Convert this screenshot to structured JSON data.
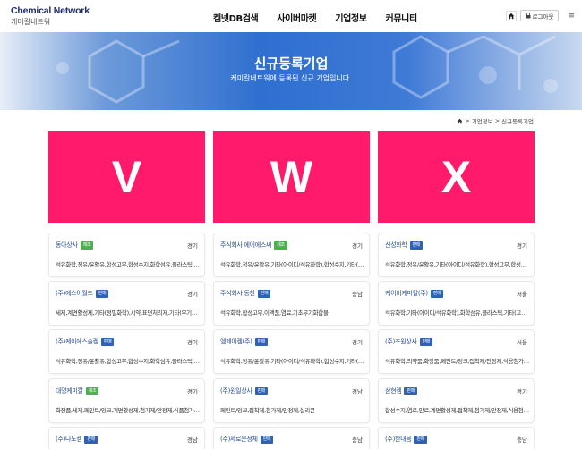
{
  "header": {
    "logo_en": "Chemical Network",
    "logo_ko": "케미칼네트워",
    "nav": [
      "켐넷DB검색",
      "사이버마켓",
      "기업정보",
      "커뮤니티"
    ],
    "login_label": "로그아웃",
    "icons": [
      "home-icon",
      "lock-icon",
      "menu-icon"
    ]
  },
  "banner": {
    "title": "신규등록기업",
    "subtitle": "케미칼네트워에 등록된 신규 기업입니다."
  },
  "breadcrumb": [
    "기업정보",
    "신규등록기업"
  ],
  "featured": [
    "V",
    "W",
    "X"
  ],
  "colors": {
    "featured_bg": "#ff1a6b",
    "badge_green": "#4caf50",
    "badge_blue": "#2f62b3",
    "link": "#2a4d8f"
  },
  "companies": [
    {
      "name": "동아상사",
      "badge": "제조",
      "badge_color": "#4caf50",
      "region": "경기",
      "desc": "석유화학,정유/윤활유,합성고무,합성수지,화학섬유,플라스틱,농..."
    },
    {
      "name": "주식회사 에이에스씨",
      "badge": "제조",
      "badge_color": "#4caf50",
      "region": "경기",
      "desc": "석유화학,정유/윤활유,기타(아이디/석유화학),합성수지,기타(고..."
    },
    {
      "name": "신성화학",
      "badge": "판매",
      "badge_color": "#2f62b3",
      "region": "경기",
      "desc": "석유화학,정유/윤활유,기타(아이디/석유화학),합성고무,합성수..."
    },
    {
      "name": "(주)에스이월드",
      "badge": "판매",
      "badge_color": "#2f62b3",
      "region": "경기",
      "desc": "세제,계면활성제,기타(정밀화학),시약,표면처리제,기타(무기화학)"
    },
    {
      "name": "주식회사 동찬",
      "badge": "판매",
      "badge_color": "#2f62b3",
      "region": "충남",
      "desc": "석유화학,합성고무,이액품,염료,기초무기화합물"
    },
    {
      "name": "케이비케미칼(주)",
      "badge": "판매",
      "badge_color": "#2f62b3",
      "region": "서울",
      "desc": "석유화학,기타(아이디/석유화학),화학섬유,플라스틱,기타(고분..."
    },
    {
      "name": "(주)케이에스솔켐",
      "badge": "판매",
      "badge_color": "#2f62b3",
      "region": "경기",
      "desc": "석유화학,정유/윤활유,합성고무,합성수지,화학섬유,플라스틱,농..."
    },
    {
      "name": "엠제이켐(주)",
      "badge": "판매",
      "badge_color": "#2f62b3",
      "region": "경기",
      "desc": "석유화학,정유/윤활유,기타(아이디/석유화학),합성수지,기타(고..."
    },
    {
      "name": "(주)조원상사",
      "badge": "판매",
      "badge_color": "#2f62b3",
      "region": "서울",
      "desc": "석유화학,의약품,화장품,페인트/잉크,접착제/안정제,식용첨가물..."
    },
    {
      "name": "대명케미칼",
      "badge": "제조",
      "badge_color": "#4caf50",
      "region": "경기",
      "desc": "화장품,세제,페인트/잉크,계면활성제,첨가제/안정제,식품첨가물..."
    },
    {
      "name": "(주)원일상사",
      "badge": "판매",
      "badge_color": "#2f62b3",
      "region": "경남",
      "desc": "페인트/잉크,접착제,첨가제/안정제,실리콘"
    },
    {
      "name": "삼현켐",
      "badge": "판매",
      "badge_color": "#2f62b3",
      "region": "경기",
      "desc": "합성수지,염료,안료,계면활성제,접착제,첨가제/안정제,식용첨가물..."
    },
    {
      "name": "(주)나노켐",
      "badge": "판매",
      "badge_color": "#2f62b3",
      "region": "경남",
      "desc": ""
    },
    {
      "name": "(주)세로운정체",
      "badge": "판매",
      "badge_color": "#2f62b3",
      "region": "충남",
      "desc": ""
    },
    {
      "name": "(주)한내음",
      "badge": "판매",
      "badge_color": "#2f62b3",
      "region": "충남",
      "desc": ""
    }
  ]
}
